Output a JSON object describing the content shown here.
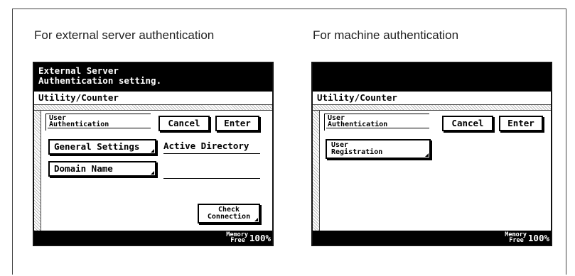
{
  "captions": {
    "left": "For external server authentication",
    "right": "For machine authentication"
  },
  "left_panel": {
    "message_line1": "External Server",
    "message_line2": "Authentication setting.",
    "utility": "Utility/Counter",
    "tab_line1": "User",
    "tab_line2": "Authentication",
    "cancel": "Cancel",
    "enter": "Enter",
    "general_settings": "General Settings",
    "general_settings_value": "Active Directory",
    "domain_name": "Domain Name",
    "domain_name_value": "",
    "check_line1": "Check",
    "check_line2": "Connection",
    "memory_line1": "Memory",
    "memory_line2": "Free",
    "memory_value": "100%"
  },
  "right_panel": {
    "message_line1": "",
    "message_line2": "",
    "utility": "Utility/Counter",
    "tab_line1": "User",
    "tab_line2": "Authentication",
    "cancel": "Cancel",
    "enter": "Enter",
    "user_reg_line1": "User",
    "user_reg_line2": "Registration",
    "memory_line1": "Memory",
    "memory_line2": "Free",
    "memory_value": "100%"
  }
}
